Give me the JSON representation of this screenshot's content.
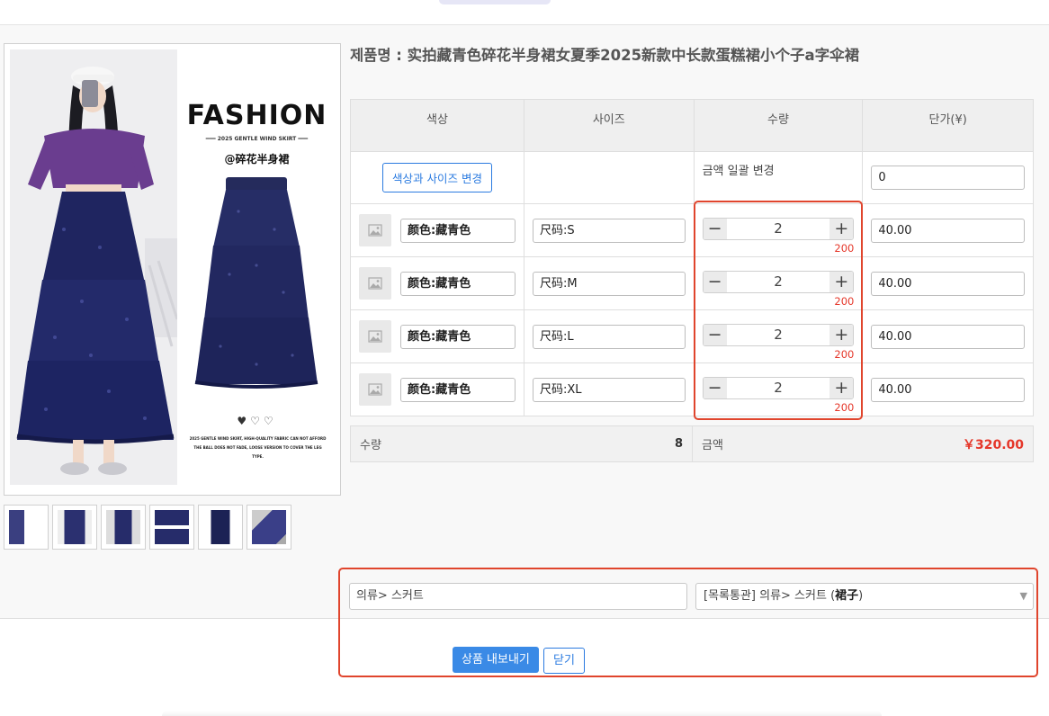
{
  "product": {
    "title": "제품명 : 实拍藏青色碎花半身裙女夏季2025新款中长款蛋糕裙小个子a字伞裙",
    "image_text": {
      "fashion": "FASHION",
      "subtitle": "━━━ 2025 GENTLE WIND SKIRT ━━━",
      "tag": "@碎花半身裙",
      "hearts": "♥♡♡",
      "fine_print": "2025 GENTLE WIND SKIRT, HIGH-QUALITY FABRIC CAN NOT AFFORD THE BALL DOES NOT FADE, LOOSE VERSION TO COVER THE LEG TYPE."
    }
  },
  "table": {
    "headers": [
      "색상",
      "사이즈",
      "수량",
      "단가(¥)"
    ],
    "bulk": {
      "change_button": "색상과 사이즈 변경",
      "bulk_label": "금액 일괄 변경",
      "bulk_price": "0"
    },
    "rows": [
      {
        "color": "颜色:藏青色",
        "size": "尺码:S",
        "qty": "2",
        "stock": "200",
        "price": "40.00"
      },
      {
        "color": "颜色:藏青色",
        "size": "尺码:M",
        "qty": "2",
        "stock": "200",
        "price": "40.00"
      },
      {
        "color": "颜色:藏青色",
        "size": "尺码:L",
        "qty": "2",
        "stock": "200",
        "price": "40.00"
      },
      {
        "color": "颜色:藏青色",
        "size": "尺码:XL",
        "qty": "2",
        "stock": "200",
        "price": "40.00"
      }
    ]
  },
  "summary": {
    "qty_label": "수량",
    "qty_value": "8",
    "amount_label": "금액",
    "amount_value": "￥320.00"
  },
  "category": {
    "input_value": "의류> 스커트",
    "select_value": "[목록통관] 의류> 스커트 (裙子)",
    "select_prefix": "[목록통관] 의류> 스커트 (",
    "select_bold": "裙子",
    "select_suffix": ")"
  },
  "actions": {
    "export": "상품 내보내기",
    "close": "닫기"
  },
  "colors": {
    "accent": "#3a8ae6",
    "highlight": "#e0452d",
    "price_red": "#e5372a"
  }
}
